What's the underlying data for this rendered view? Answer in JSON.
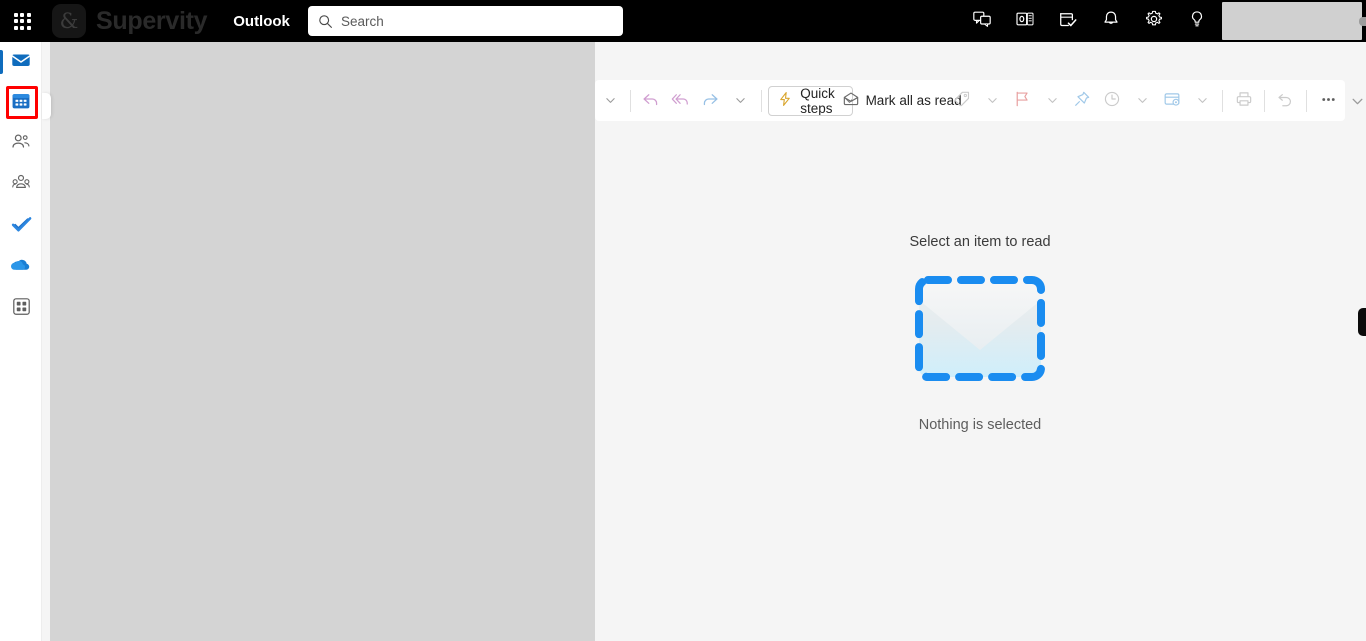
{
  "topbar": {
    "waffle_label": "App launcher",
    "brand": {
      "mark": "&",
      "name": "Supervity"
    },
    "app_name": "Outlook",
    "search": {
      "placeholder": "Search",
      "value": ""
    },
    "actions": [
      {
        "name": "teams-chat-icon",
        "label": "Teams chat"
      },
      {
        "name": "outlook-calendar-icon",
        "label": "Calendar"
      },
      {
        "name": "to-do-icon",
        "label": "To Do"
      },
      {
        "name": "notifications-bell-icon",
        "label": "Notifications"
      },
      {
        "name": "settings-gear-icon",
        "label": "Settings"
      },
      {
        "name": "tips-lightbulb-icon",
        "label": "Tips"
      }
    ],
    "account_skeleton_label": ""
  },
  "rail": {
    "items": [
      {
        "name": "sidebar-item-mail",
        "label": "Mail",
        "active": true
      },
      {
        "name": "sidebar-item-calendar",
        "label": "Calendar",
        "active": false,
        "highlighted": true
      },
      {
        "name": "sidebar-item-people",
        "label": "People",
        "active": false
      },
      {
        "name": "sidebar-item-groups",
        "label": "Groups",
        "active": false
      },
      {
        "name": "sidebar-item-to-do",
        "label": "To Do",
        "active": false
      },
      {
        "name": "sidebar-item-onedrive",
        "label": "OneDrive",
        "active": false
      },
      {
        "name": "sidebar-item-more-apps",
        "label": "More apps",
        "active": false
      }
    ],
    "highlight_color": "#ff0000",
    "active_indicator_color": "#0f6cbd"
  },
  "toolbar": {
    "overflow_caret_label": "More commands",
    "items": [
      {
        "name": "toolbar-leading-caret",
        "label": "",
        "type": "caret"
      },
      {
        "name": "toolbar-separator-1",
        "label": "",
        "type": "separator"
      },
      {
        "name": "reply-button",
        "label": "Reply",
        "type": "icon",
        "icon": "reply-icon",
        "color": "#d6a3d6"
      },
      {
        "name": "reply-all-button",
        "label": "Reply all",
        "type": "icon",
        "icon": "reply-all-icon",
        "color": "#d6a3d6"
      },
      {
        "name": "forward-button",
        "label": "Forward",
        "type": "icon",
        "icon": "forward-icon",
        "color": "#9ec4e8"
      },
      {
        "name": "forward-caret",
        "label": "",
        "type": "caret"
      },
      {
        "name": "toolbar-separator-2",
        "label": "",
        "type": "separator"
      },
      {
        "name": "quick-steps-button",
        "label": "Quick steps",
        "type": "split",
        "icon": "lightning-bolt-icon",
        "color": "#d9a62e"
      },
      {
        "name": "mark-all-as-read-button",
        "label": "Mark all as read",
        "type": "labeled",
        "icon": "open-envelope-icon",
        "color": "#6b6b6b"
      },
      {
        "name": "categorize-button",
        "label": "Categorize",
        "type": "icon",
        "icon": "tag-icon",
        "color": "#cfcfcf"
      },
      {
        "name": "categorize-caret",
        "label": "",
        "type": "caret"
      },
      {
        "name": "flag-button",
        "label": "Flag",
        "type": "icon",
        "icon": "flag-icon",
        "color": "#e8a6a6"
      },
      {
        "name": "flag-caret",
        "label": "",
        "type": "caret"
      },
      {
        "name": "pin-button",
        "label": "Pin",
        "type": "icon",
        "icon": "pin-icon",
        "color": "#a9cdeb"
      },
      {
        "name": "snooze-button",
        "label": "Snooze",
        "type": "icon",
        "icon": "clock-icon",
        "color": "#cfcfcf"
      },
      {
        "name": "snooze-caret",
        "label": "",
        "type": "caret"
      },
      {
        "name": "rules-button",
        "label": "Rules",
        "type": "icon",
        "icon": "rules-icon",
        "color": "#a9cdeb"
      },
      {
        "name": "rules-caret",
        "label": "",
        "type": "caret"
      },
      {
        "name": "toolbar-separator-3",
        "label": "",
        "type": "separator"
      },
      {
        "name": "print-button",
        "label": "Print",
        "type": "icon",
        "icon": "printer-icon",
        "color": "#cfcfcf"
      },
      {
        "name": "toolbar-separator-4",
        "label": "",
        "type": "separator"
      },
      {
        "name": "undo-button",
        "label": "Undo",
        "type": "icon",
        "icon": "undo-icon",
        "color": "#cfcfcf"
      },
      {
        "name": "toolbar-separator-5",
        "label": "",
        "type": "separator"
      },
      {
        "name": "more-commands-button",
        "label": "More commands",
        "type": "icon",
        "icon": "ellipsis-icon",
        "color": "#5a5a5a"
      }
    ],
    "quick_steps_label": "Quick steps",
    "mark_all_read_label": "Mark all as read"
  },
  "reading_pane": {
    "title": "Select an item to read",
    "subtitle": "Nothing is selected",
    "illustration": "dashed-envelope-icon",
    "dash_color": "#1a8cf0"
  },
  "loading": {
    "pane_label": "Message list loading",
    "color": "#d4d4d4"
  },
  "edge_handle": {
    "name": "right-panel-handle",
    "label": "Open side pane"
  }
}
